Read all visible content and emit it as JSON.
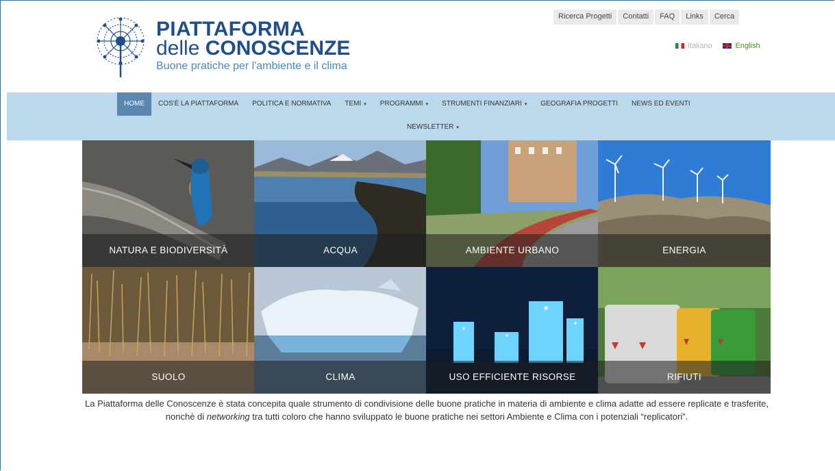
{
  "logo": {
    "title_line1": "PIATTAFORMA",
    "title_line2_a": "delle ",
    "title_line2_b": "CONOSCENZE",
    "subtitle": "Buone pratiche per l'ambiente e il clima"
  },
  "toplinks": [
    "Ricerca Progetti",
    "Contatti",
    "FAQ",
    "Links",
    "Cerca"
  ],
  "languages": {
    "italian": "Italiano",
    "english": "English"
  },
  "nav": {
    "row1": [
      {
        "label": "HOME",
        "active": true
      },
      {
        "label": "COS'È LA PIATTAFORMA"
      },
      {
        "label": "POLITICA E NORMATIVA"
      },
      {
        "label": "TEMI",
        "caret": "▾"
      },
      {
        "label": "PROGRAMMI",
        "caret": "▾"
      },
      {
        "label": "STRUMENTI FINANZIARI",
        "caret": "▾"
      },
      {
        "label": "GEOGRAFIA PROGETTI"
      },
      {
        "label": "NEWS ED EVENTI"
      }
    ],
    "row2": [
      {
        "label": "NEWSLETTER",
        "caret": "▾"
      }
    ]
  },
  "tiles": [
    "NATURA E BIODIVERSITÀ",
    "ACQUA",
    "AMBIENTE URBANO",
    "ENERGIA",
    "SUOLO",
    "CLIMA",
    "USO EFFICIENTE RISORSE",
    "RIFIUTI"
  ],
  "intro": {
    "part1": "La Piattaforma delle Conoscenze è stata concepita quale strumento di condivisione delle buone pratiche in materia di ambiente e clima adatte ad essere replicate e trasferite, nonchè di ",
    "emphasis": "networking",
    "part2": " tra tutti coloro che hanno sviluppato le buone pratiche nei settori Ambiente e Clima con i potenziali “replicatori”."
  }
}
